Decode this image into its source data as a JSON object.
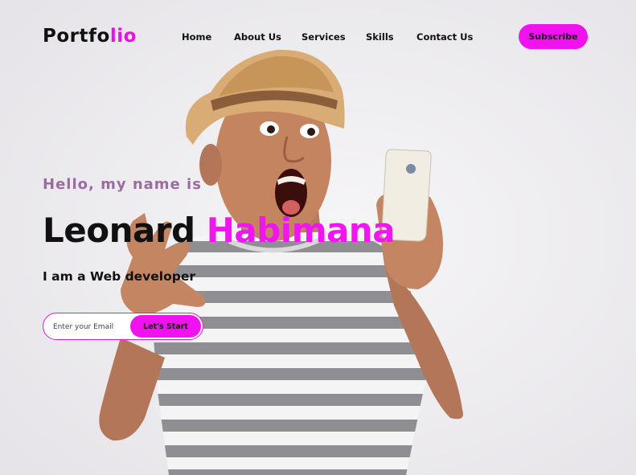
{
  "logo": {
    "text_main": "Portfo",
    "text_accent": "lio"
  },
  "nav": {
    "items": [
      {
        "label": "Home"
      },
      {
        "label": "About Us"
      },
      {
        "label": "Services"
      },
      {
        "label": "Skills"
      },
      {
        "label": "Contact Us"
      }
    ],
    "subscribe_label": "Subscribe"
  },
  "hero": {
    "greeting": "Hello, my name is",
    "first_name": "Leonard",
    "last_name": "Habimana",
    "tagline": "I am a Web developer",
    "email_placeholder": "Enter your Email",
    "cta_label": "Let's Start"
  },
  "colors": {
    "accent": "#f012ef",
    "greeting": "#9a6da0",
    "text": "#111111",
    "background": "#eceaee"
  }
}
